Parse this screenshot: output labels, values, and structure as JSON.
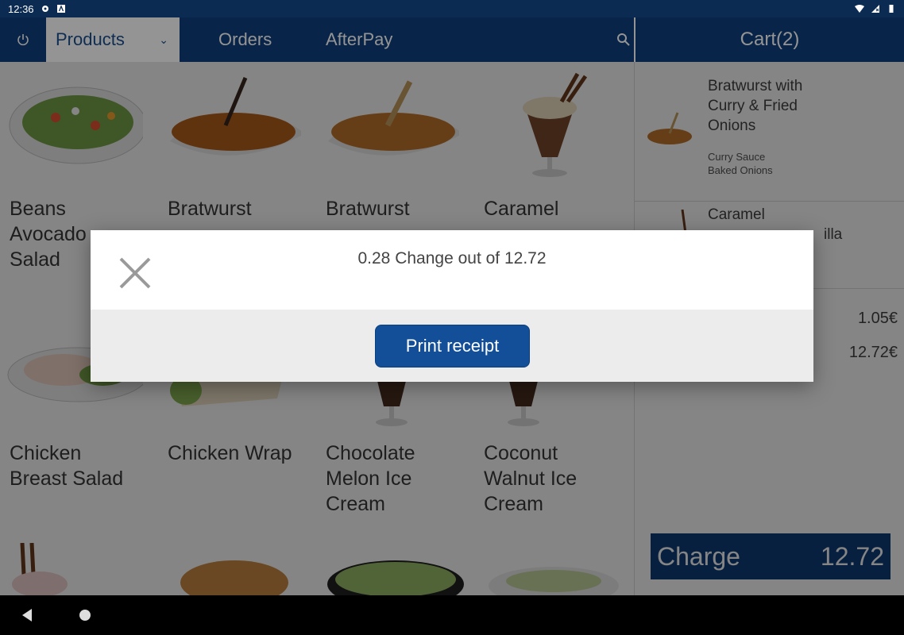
{
  "status_bar": {
    "time": "12:36"
  },
  "app_bar": {
    "tabs": [
      {
        "label": "Products"
      },
      {
        "label": "Orders"
      },
      {
        "label": "AfterPay"
      }
    ],
    "cart_title": "Cart(2)"
  },
  "products": [
    {
      "name_lines": [
        "Beans",
        "Avocado",
        "Salad"
      ]
    },
    {
      "name_lines": [
        "Bratwurst"
      ]
    },
    {
      "name_lines": [
        "Bratwurst"
      ]
    },
    {
      "name_lines": [
        "Caramel"
      ]
    },
    {
      "name_lines": [
        "Chicken",
        "Breast Salad"
      ]
    },
    {
      "name_lines": [
        "Chicken Wrap"
      ]
    },
    {
      "name_lines": [
        "Chocolate",
        "Melon Ice",
        "Cream"
      ]
    },
    {
      "name_lines": [
        "Coconut",
        "Walnut Ice",
        "Cream"
      ]
    }
  ],
  "cart": {
    "items": [
      {
        "title_lines": [
          "Bratwurst with",
          "Curry & Fried",
          "Onions"
        ],
        "modifiers": [
          "Curry Sauce",
          "Baked Onions"
        ]
      },
      {
        "title_lines": [
          "Caramel",
          "illa"
        ]
      }
    ],
    "line_values": [
      "1.05€",
      "12.72€"
    ],
    "charge_label": "Charge",
    "charge_amount": "12.72"
  },
  "dialog": {
    "message": "0.28 Change out of 12.72",
    "print_button": "Print receipt"
  },
  "colors": {
    "primary": "#0e3e7c",
    "button": "#124f98"
  }
}
